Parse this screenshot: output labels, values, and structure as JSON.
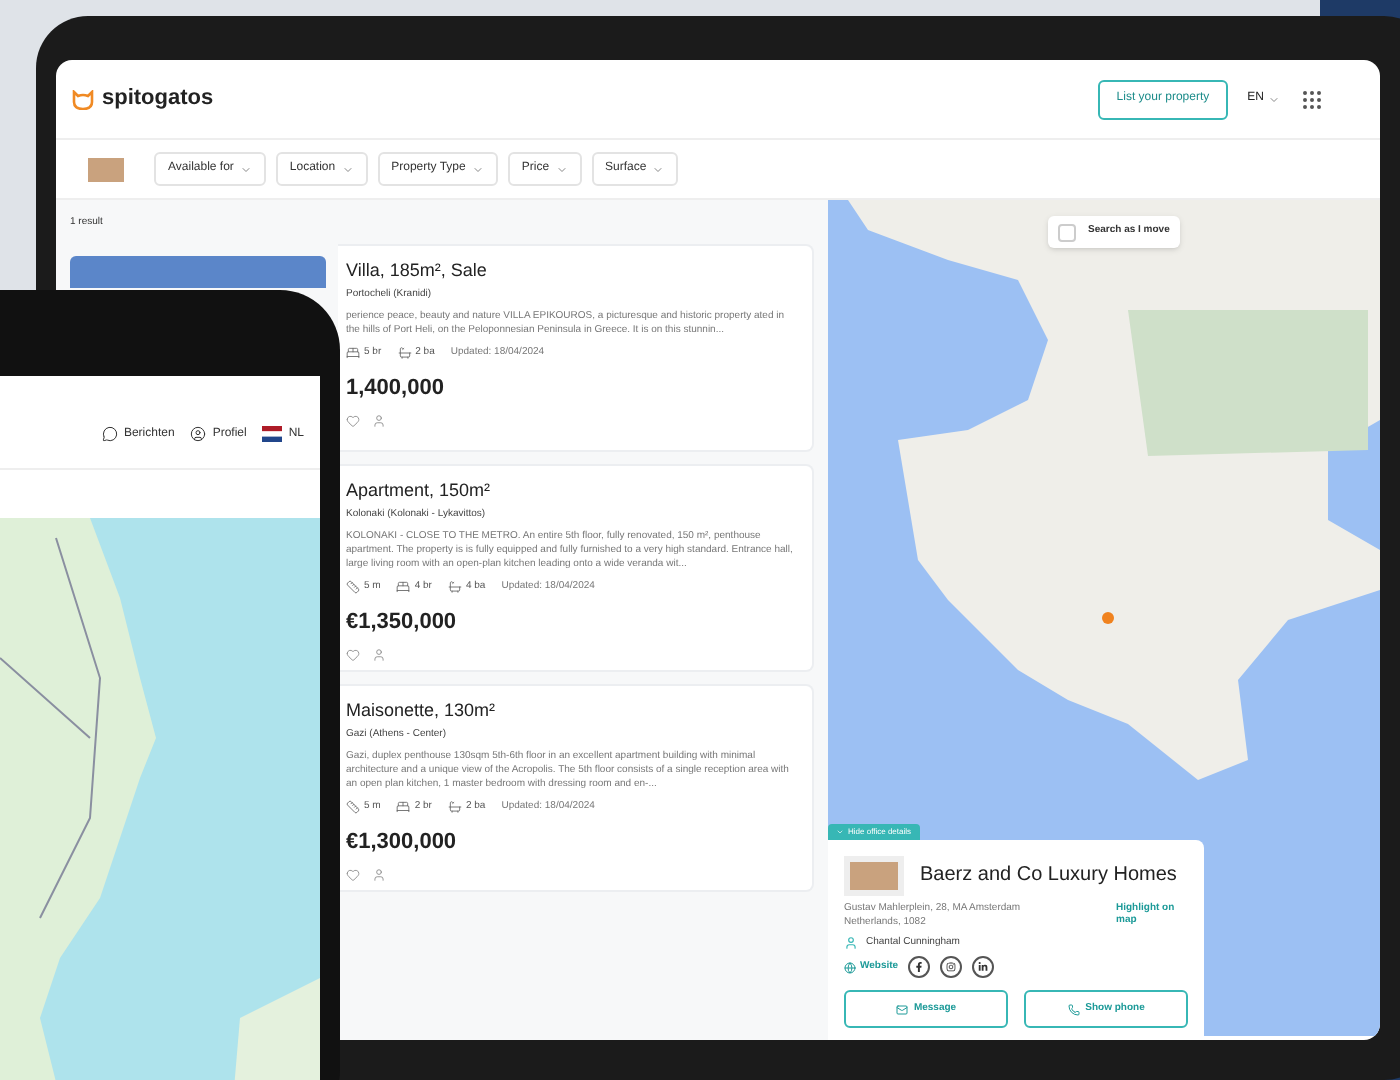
{
  "header": {
    "logo": "spitogatos",
    "list_button": "List your property",
    "language": "EN"
  },
  "filters": [
    {
      "label": "Available for"
    },
    {
      "label": "Location"
    },
    {
      "label": "Property Type"
    },
    {
      "label": "Price"
    },
    {
      "label": "Surface"
    }
  ],
  "results_count": "1 result",
  "listings": [
    {
      "title": "Villa, 185m², Sale",
      "location": "Portocheli (Kranidi)",
      "description": "perience peace, beauty and nature VILLA EPIKOUROS, a picturesque and historic property ated in the hills of Port Heli, on the Peloponnesian Peninsula in Greece. It is on this stunnin...",
      "features": [
        {
          "kind": "bedrooms",
          "text": "5 br"
        },
        {
          "kind": "bathrooms",
          "text": "2 ba"
        }
      ],
      "updated": "Updated: 18/04/2024",
      "price": "1,400,000"
    },
    {
      "title": "Apartment, 150m²",
      "location": "Kolonaki (Kolonaki - Lykavittos)",
      "description": "KOLONAKI - CLOSE TO THE METRO. An entire 5th floor, fully renovated, 150 m², penthouse apartment. The property is is fully equipped and fully furnished to a very high standard. Entrance hall, large living room with an open-plan kitchen leading onto a wide veranda wit...",
      "features": [
        {
          "kind": "area",
          "text": "5 m"
        },
        {
          "kind": "bedrooms",
          "text": "4 br"
        },
        {
          "kind": "bathrooms",
          "text": "4 ba"
        }
      ],
      "updated": "Updated: 18/04/2024",
      "price": "€1,350,000"
    },
    {
      "title": "Maisonette, 130m²",
      "location": "Gazi (Athens - Center)",
      "description": "Gazi, duplex penthouse 130sqm 5th-6th floor in an excellent apartment building with minimal architecture and a unique view of the Acropolis. The 5th floor consists of a single reception area with an open plan kitchen, 1 master bedroom with dressing room and en-...",
      "features": [
        {
          "kind": "area",
          "text": "5 m"
        },
        {
          "kind": "bedrooms",
          "text": "2 br"
        },
        {
          "kind": "bathrooms",
          "text": "2 ba"
        }
      ],
      "updated": "Updated: 18/04/2024",
      "price": "€1,300,000"
    }
  ],
  "map": {
    "search_toggle": {
      "label": "Search as I move",
      "checked": false
    },
    "office_toggle": "Hide office details"
  },
  "office": {
    "name": "Baerz and Co Luxury Homes",
    "address": "Gustav Mahlerplein, 28, MA Amsterdam Netherlands, 1082",
    "highlight": "Highlight on map",
    "agent": "Chantal Cunningham",
    "website": "Website",
    "buttons": [
      {
        "kind": "message",
        "label": "Message"
      },
      {
        "kind": "phone",
        "label": "Show phone"
      }
    ]
  },
  "phone": {
    "nav": [
      {
        "kind": "messages",
        "label": "Berichten"
      },
      {
        "kind": "profile",
        "label": "Profiel"
      },
      {
        "kind": "language",
        "label": "NL"
      }
    ]
  }
}
